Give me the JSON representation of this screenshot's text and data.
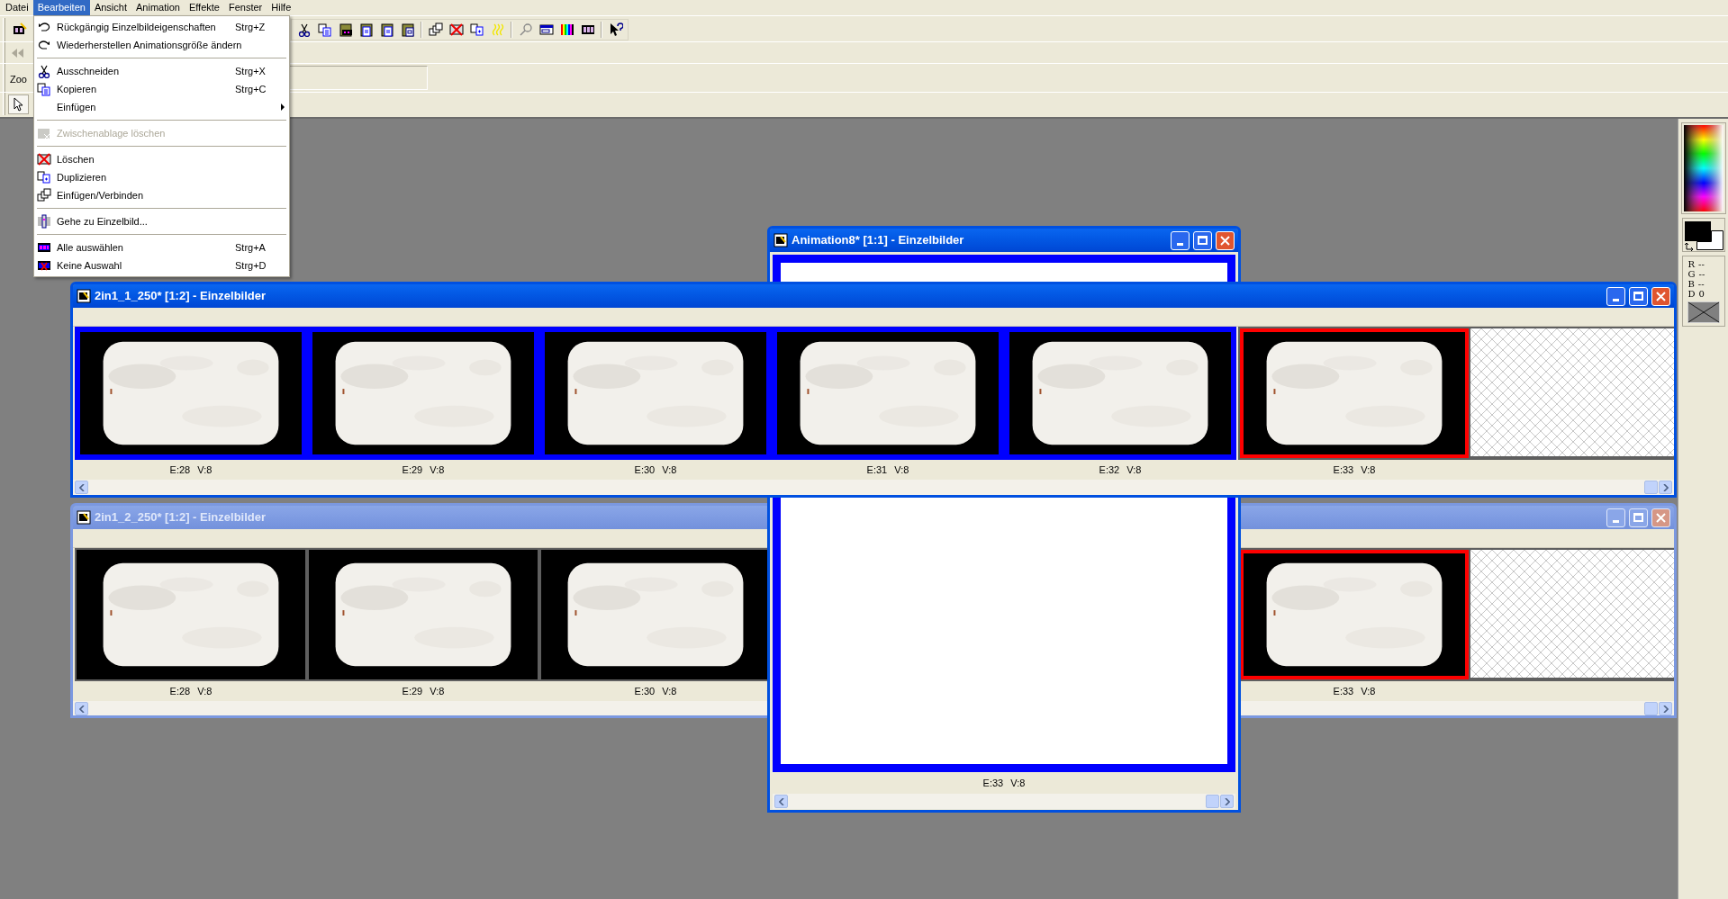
{
  "menubar": [
    {
      "label": "Datei",
      "selected": false
    },
    {
      "label": "Bearbeiten",
      "selected": true
    },
    {
      "label": "Ansicht",
      "selected": false
    },
    {
      "label": "Animation",
      "selected": false
    },
    {
      "label": "Effekte",
      "selected": false
    },
    {
      "label": "Fenster",
      "selected": false
    },
    {
      "label": "Hilfe",
      "selected": false
    }
  ],
  "edit_menu": {
    "groups": [
      [
        {
          "label": "Rückgängig Einzelbildeigenschaften",
          "shortcut": "Strg+Z",
          "disabled": false,
          "submenu": false
        },
        {
          "label": "Wiederherstellen Animationsgröße ändern",
          "disabled": false,
          "submenu": false
        }
      ],
      [
        {
          "label": "Ausschneiden",
          "shortcut": "Strg+X",
          "disabled": false,
          "submenu": false
        },
        {
          "label": "Kopieren",
          "shortcut": "Strg+C",
          "disabled": false,
          "submenu": false
        },
        {
          "label": "Einfügen",
          "disabled": false,
          "submenu": true
        }
      ],
      [
        {
          "label": "Zwischenablage löschen",
          "disabled": true,
          "submenu": false
        }
      ],
      [
        {
          "label": "Löschen",
          "disabled": false,
          "submenu": false
        },
        {
          "label": "Duplizieren",
          "disabled": false,
          "submenu": false
        },
        {
          "label": "Einfügen/Verbinden",
          "disabled": false,
          "submenu": false
        }
      ],
      [
        {
          "label": "Gehe zu Einzelbild...",
          "disabled": false,
          "submenu": false
        }
      ],
      [
        {
          "label": "Alle auswählen",
          "shortcut": "Strg+A",
          "disabled": false,
          "submenu": false
        },
        {
          "label": "Keine Auswahl",
          "shortcut": "Strg+D",
          "disabled": false,
          "submenu": false
        }
      ]
    ]
  },
  "toolbar": {
    "zoom_label": "Zoo"
  },
  "frames_window_1": {
    "title": "2in1_1_250* [1:2] - Einzelbilder",
    "active": true,
    "frames": [
      {
        "label": "E:28 V:8",
        "selected": true,
        "current": false
      },
      {
        "label": "E:29 V:8",
        "selected": true,
        "current": false
      },
      {
        "label": "E:30 V:8",
        "selected": true,
        "current": false
      },
      {
        "label": "E:31 V:8",
        "selected": true,
        "current": false
      },
      {
        "label": "E:32 V:8",
        "selected": true,
        "current": false
      },
      {
        "label": "E:33 V:8",
        "selected": false,
        "current": true
      }
    ]
  },
  "animation_window": {
    "title": "Animation8* [1:1] - Einzelbilder",
    "active": true,
    "frames": [
      {
        "label": "E:33 V:8",
        "selected": true,
        "current": false
      }
    ]
  },
  "frames_window_2": {
    "title": "2in1_2_250* [1:2] - Einzelbilder",
    "active": false,
    "frames": [
      {
        "label": "E:28 V:8",
        "selected": false,
        "current": false
      },
      {
        "label": "E:29 V:8",
        "selected": false,
        "current": false
      },
      {
        "label": "E:30 V:8",
        "selected": false,
        "current": false
      },
      {
        "label": "E:33 V:8",
        "selected": false,
        "current": true
      }
    ]
  },
  "color_info": [
    {
      "channel": "R",
      "value": "--"
    },
    {
      "channel": "G",
      "value": "--"
    },
    {
      "channel": "B",
      "value": "--"
    },
    {
      "channel": "D",
      "value": "0"
    }
  ]
}
